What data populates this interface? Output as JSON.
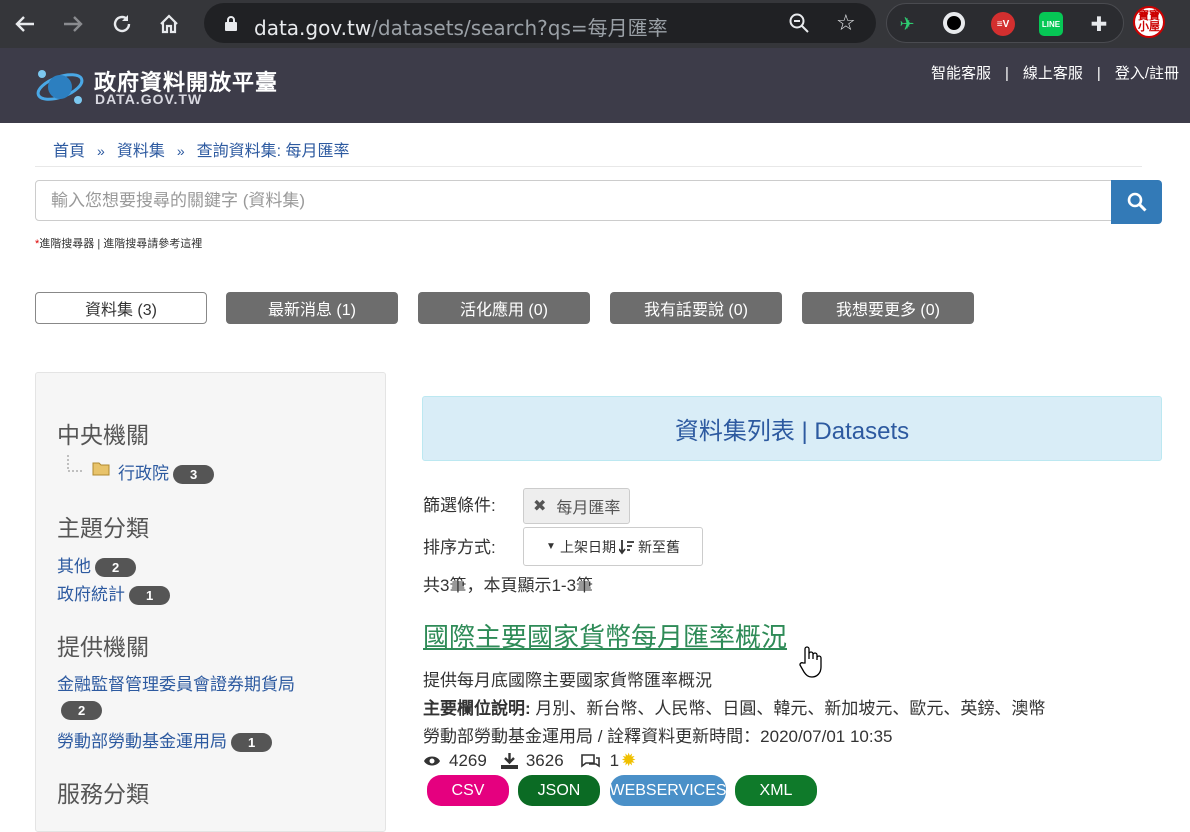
{
  "browser": {
    "url_host": "data.gov.tw",
    "url_path": "/datasets/search?qs=每月匯率",
    "icons": [
      "back-icon",
      "forward-icon",
      "reload-icon",
      "home-icon",
      "lock-icon",
      "zoom-icon",
      "star-icon",
      "puzzle-icon"
    ],
    "profile_text": "寶寶小屋"
  },
  "site": {
    "name_zh": "政府資料開放平臺",
    "name_en": "DATA.GOV.TW",
    "top_links": [
      "智能客服",
      "線上客服",
      "登入/註冊"
    ]
  },
  "breadcrumb": [
    "首頁",
    "資料集",
    "查詢資料集: 每月匯率"
  ],
  "search": {
    "placeholder": "輸入您想要搜尋的關鍵字 (資料集)",
    "note_star": "*",
    "note_text": "進階搜尋器 | 進階搜尋請參考這裡"
  },
  "tabs": [
    "資料集 (3)",
    "最新消息 (1)",
    "活化應用 (0)",
    "我有話要說 (0)",
    "我想要更多 (0)"
  ],
  "sidebar": {
    "central_heading": "中央機關",
    "central_items": [
      {
        "label": "行政院",
        "count": "3"
      }
    ],
    "topic_heading": "主題分類",
    "topic_items": [
      {
        "label": "其他",
        "count": "2"
      },
      {
        "label": "政府統計",
        "count": "1"
      }
    ],
    "provider_heading": "提供機關",
    "provider_items": [
      {
        "label": "金融監督管理委員會證券期貨局",
        "count": "2"
      },
      {
        "label": "勞動部勞動基金運用局",
        "count": "1"
      }
    ],
    "service_heading": "服務分類"
  },
  "main": {
    "panel_title": "資料集列表 | Datasets",
    "filter_label": "篩選條件:",
    "filter_chip": "每月匯率",
    "sort_label": "排序方式:",
    "sort_field": "上架日期",
    "sort_order": "新至舊",
    "summary": "共3筆，本頁顯示1-3筆",
    "dataset": {
      "title": "國際主要國家貨幣每月匯率概況",
      "description": "提供每月底國際主要國家貨幣匯率概況",
      "fields_label": "主要欄位說明:",
      "fields_value": "月別、新台幣、人民幣、日圓、韓元、新加坡元、歐元、英鎊、澳幣",
      "provider_line": "勞動部勞動基金運用局 / 詮釋資料更新時間：2020/07/01 10:35",
      "views": "4269",
      "downloads": "3626",
      "comments": "1",
      "formats": [
        {
          "label": "CSV",
          "color": "#e5007f"
        },
        {
          "label": "JSON",
          "color": "#0b6b24"
        },
        {
          "label": "WEBSERVICES",
          "color": "#4a90c8"
        },
        {
          "label": "XML",
          "color": "#0f7a2a"
        }
      ]
    }
  }
}
